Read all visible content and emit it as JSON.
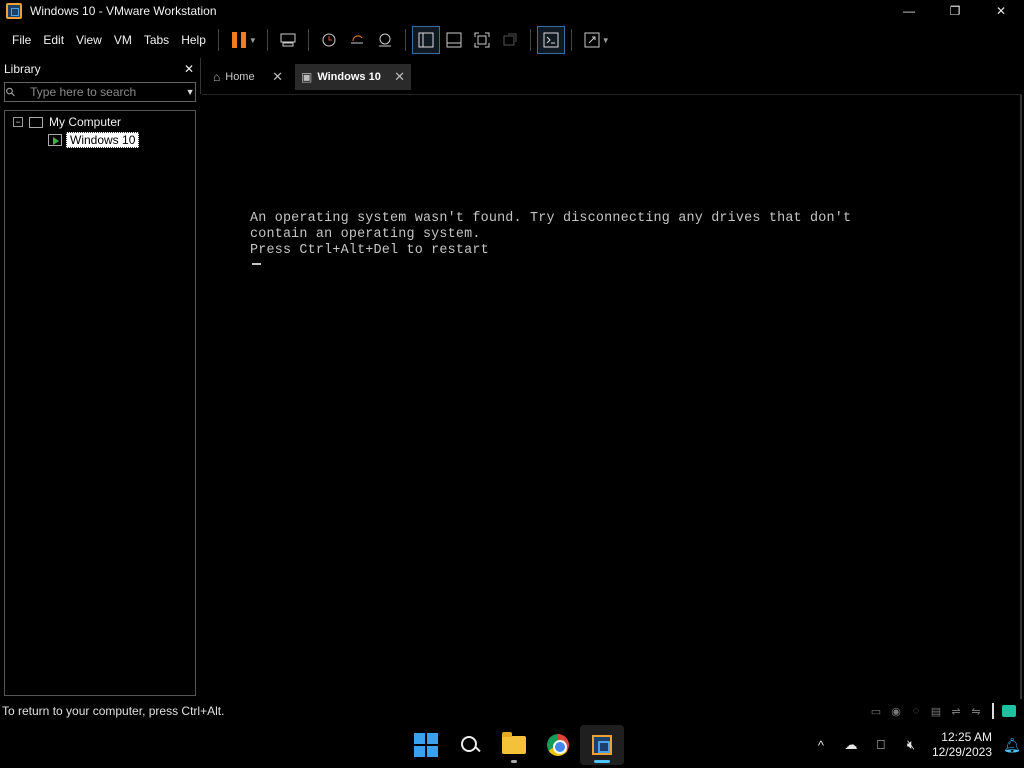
{
  "window": {
    "title": "Windows 10 - VMware Workstation",
    "minimize_glyph": "—",
    "restore_glyph": "❐",
    "close_glyph": "✕"
  },
  "menu": {
    "items": [
      "File",
      "Edit",
      "View",
      "VM",
      "Tabs",
      "Help"
    ]
  },
  "library": {
    "title": "Library",
    "close_glyph": "✕",
    "search_placeholder": "Type here to search",
    "tree": {
      "root_label": "My Computer",
      "toggle_glyph": "−",
      "vm_label": "Windows 10"
    }
  },
  "tabs": [
    {
      "label": "Home",
      "close_glyph": "✕"
    },
    {
      "label": "Windows 10",
      "close_glyph": "✕"
    }
  ],
  "vm_console": {
    "line1": "An operating system wasn't found. Try disconnecting any drives that don't",
    "line2": "contain an operating system.",
    "line3": "Press Ctrl+Alt+Del to restart"
  },
  "statusbar": {
    "text": "To return to your computer, press Ctrl+Alt."
  },
  "taskbar": {
    "clock_time": "12:25 AM",
    "clock_date": "12/29/2023",
    "tray_chevron": "^"
  },
  "colors": {
    "pause_accent": "#f07c1e",
    "active_indicator": "#4cc2ff",
    "console_text": "#c4c4c4"
  }
}
